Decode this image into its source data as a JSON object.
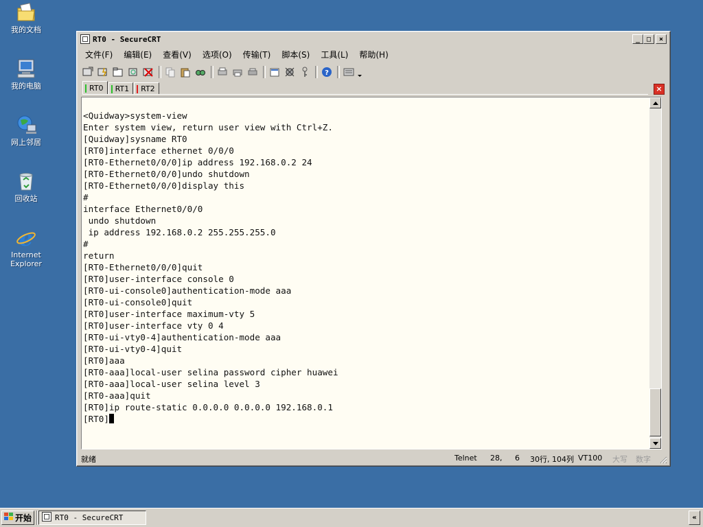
{
  "desktop": {
    "icons": [
      {
        "label": "我的文档",
        "icon": "my-documents-icon"
      },
      {
        "label": "我的电脑",
        "icon": "my-computer-icon"
      },
      {
        "label": "网上邻居",
        "icon": "network-icon"
      },
      {
        "label": "回收站",
        "icon": "recycle-bin-icon"
      },
      {
        "label": "Internet Explorer",
        "icon": "internet-explorer-icon"
      }
    ]
  },
  "window": {
    "title": "RT0 - SecureCRT",
    "menu": [
      "文件(F)",
      "编辑(E)",
      "查看(V)",
      "选项(O)",
      "传输(T)",
      "脚本(S)",
      "工具(L)",
      "帮助(H)"
    ],
    "tabs": [
      {
        "label": "RT0",
        "color": "#2bbf2b"
      },
      {
        "label": "RT1",
        "color": "#2bbf2b"
      },
      {
        "label": "RT2",
        "color": "#e02020"
      }
    ],
    "terminal_lines": [
      "<Quidway>system-view",
      "Enter system view, return user view with Ctrl+Z.",
      "[Quidway]sysname RT0",
      "[RT0]interface ethernet 0/0/0",
      "[RT0-Ethernet0/0/0]ip address 192.168.0.2 24",
      "[RT0-Ethernet0/0/0]undo shutdown",
      "[RT0-Ethernet0/0/0]display this",
      "#",
      "interface Ethernet0/0/0",
      " undo shutdown",
      " ip address 192.168.0.2 255.255.255.0",
      "#",
      "return",
      "[RT0-Ethernet0/0/0]quit",
      "[RT0]user-interface console 0",
      "[RT0-ui-console0]authentication-mode aaa",
      "[RT0-ui-console0]quit",
      "[RT0]user-interface maximum-vty 5",
      "[RT0]user-interface vty 0 4",
      "[RT0-ui-vty0-4]authentication-mode aaa",
      "[RT0-ui-vty0-4]quit",
      "[RT0]aaa",
      "[RT0-aaa]local-user selina password cipher huawei",
      "[RT0-aaa]local-user selina level 3",
      "[RT0-aaa]quit",
      "[RT0]ip route-static 0.0.0.0 0.0.0.0 192.168.0.1"
    ],
    "prompt": "[RT0]",
    "status": {
      "ready": "就绪",
      "protocol": "Telnet",
      "row": "28,",
      "col": "6",
      "size": "30行, 104列",
      "emulation": "VT100",
      "caps": "大写",
      "num": "数字"
    }
  },
  "taskbar": {
    "start_label": "开始",
    "task_label": "RT0 - SecureCRT",
    "tray_toggle": "«"
  }
}
